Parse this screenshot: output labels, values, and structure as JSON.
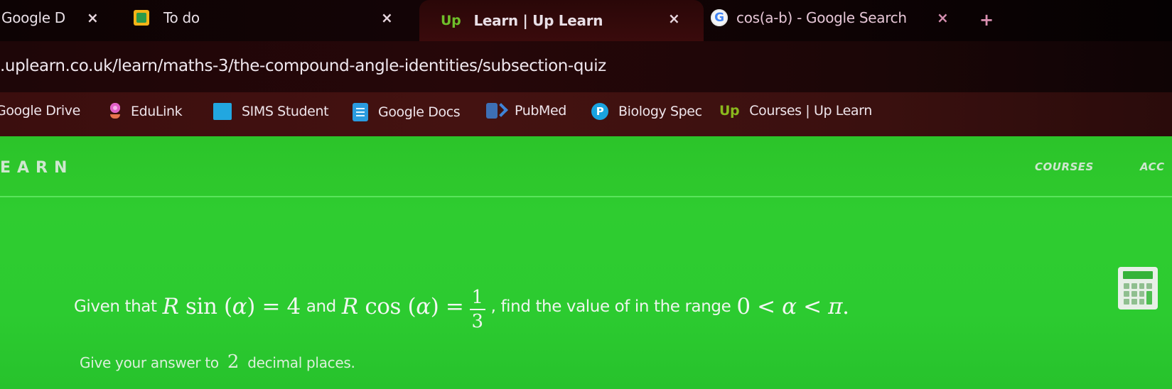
{
  "browser": {
    "tabs": [
      {
        "title": "Google D",
        "icon": "none",
        "active": false
      },
      {
        "title": "To do",
        "icon": "google-classroom-icon",
        "active": false
      },
      {
        "title": "Learn | Up Learn",
        "icon": "up-learn-icon",
        "active": true
      },
      {
        "title": "cos(a-b) - Google Search",
        "icon": "google-icon",
        "active": false
      }
    ],
    "close_glyph": "×",
    "new_tab_glyph": "+",
    "url": ".uplearn.co.uk/learn/maths-3/the-compound-angle-identities/subsection-quiz",
    "bookmarks": [
      {
        "label": "Google Drive",
        "icon": "none"
      },
      {
        "label": "EduLink",
        "icon": "edulink-icon"
      },
      {
        "label": "SIMS Student",
        "icon": "sims-icon"
      },
      {
        "label": "Google Docs",
        "icon": "google-docs-icon"
      },
      {
        "label": "PubMed",
        "icon": "pubmed-icon"
      },
      {
        "label": "Biology Spec",
        "icon": "pearson-icon"
      },
      {
        "label": "Courses | Up Learn",
        "icon": "up-learn-icon"
      }
    ],
    "icon_text": {
      "up": "Up",
      "google": "G",
      "pearson": "P"
    }
  },
  "page": {
    "logo": "EARN",
    "nav": {
      "courses": "COURSES",
      "account": "ACC"
    },
    "question": {
      "prefix": "Given that",
      "eq1": {
        "coef": "R",
        "func": "sin",
        "arg": "α",
        "rhs": "4"
      },
      "joiner": "and",
      "eq2": {
        "coef": "R",
        "func": "cos",
        "arg": "α",
        "rhs_num": "1",
        "rhs_den": "3"
      },
      "middle": ", find the value of in the range",
      "range": {
        "low": "0",
        "var": "α",
        "high": "π",
        "end": "."
      }
    },
    "instruction": {
      "before": "Give your answer to",
      "number": "2",
      "after": "decimal places."
    },
    "colors": {
      "brand_green": "#2ecb30",
      "text_light": "#eef5ee"
    }
  }
}
